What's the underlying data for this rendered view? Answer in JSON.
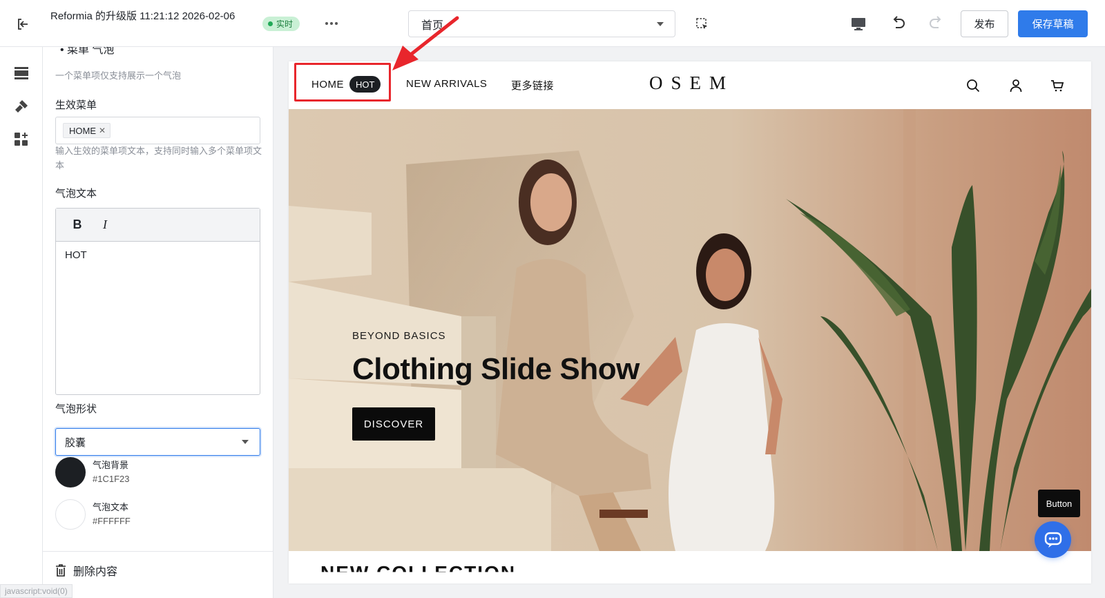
{
  "topbar": {
    "title": "Reformia 的升级版 11:21:12 2026-02-06",
    "status_badge": "实时",
    "page_select_value": "首页",
    "publish_label": "发布",
    "save_label": "保存草稿"
  },
  "panel": {
    "cut_title": "• 菜单 气泡",
    "hint_top": "一个菜单项仅支持展示一个气泡",
    "active_menu_label": "生效菜单",
    "active_menu_tags": [
      "HOME"
    ],
    "active_menu_hint": "输入生效的菜单项文本，支持同时输入多个菜单项文本",
    "bubble_text_label": "气泡文本",
    "bubble_text_value": "HOT",
    "bubble_shape_label": "气泡形状",
    "bubble_shape_value": "胶囊",
    "bg_color": {
      "name": "气泡背景",
      "hex": "#1C1F23"
    },
    "text_color": {
      "name": "气泡文本",
      "hex": "#FFFFFF"
    },
    "delete_label": "删除内容"
  },
  "status_link": "javascript:void(0)",
  "store": {
    "nav": {
      "home": "HOME",
      "hot": "HOT",
      "new_arrivals": "NEW ARRIVALS",
      "more_links": "更多链接"
    },
    "logo": "OSEM",
    "hero": {
      "eyebrow": "BEYOND BASICS",
      "title": "Clothing Slide Show",
      "button": "DISCOVER"
    },
    "next_heading": "NEW COLLECTION"
  },
  "tooltip": "Button",
  "colors": {
    "accent": "#2F7BEA",
    "bubble_bg": "#1C1F23",
    "bubble_text": "#FFFFFF",
    "highlight": "#E8262C"
  }
}
